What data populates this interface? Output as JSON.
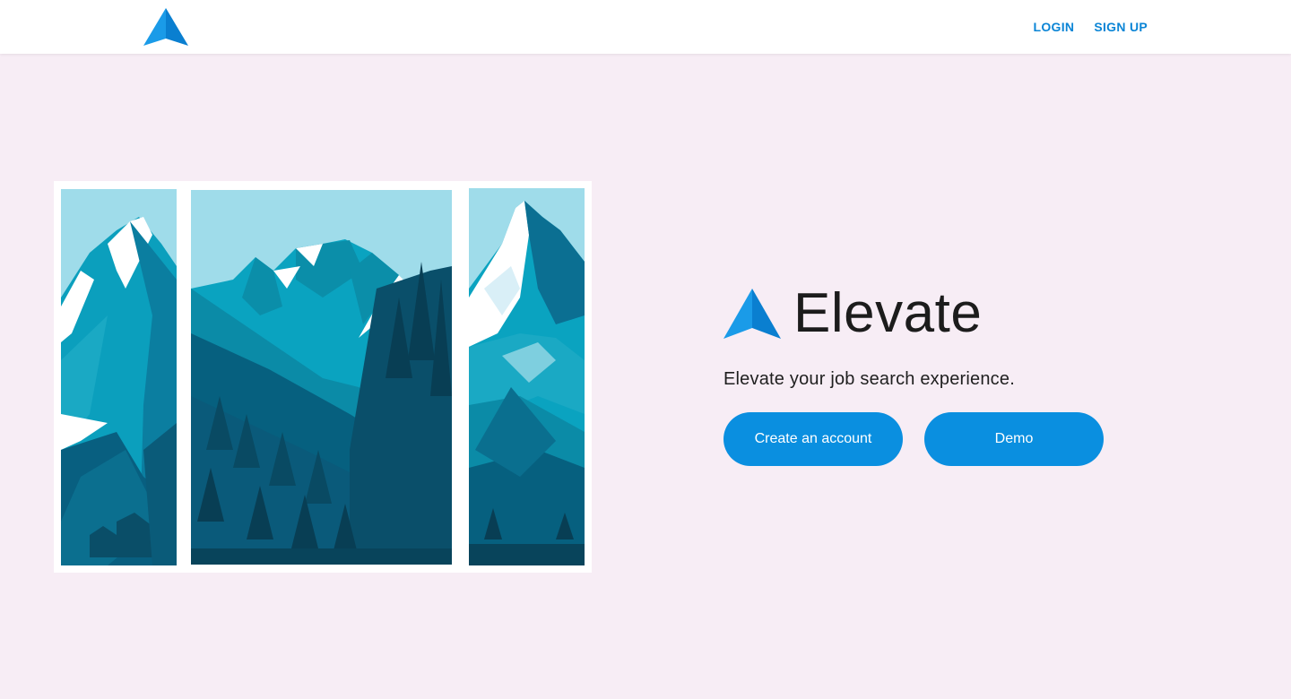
{
  "nav": {
    "logo_icon": "elevate-arrow-logo-icon",
    "links": [
      {
        "label": "LOGIN"
      },
      {
        "label": "SIGN UP"
      }
    ]
  },
  "hero": {
    "brand_icon": "elevate-arrow-logo-icon",
    "brand_name": "Elevate",
    "tagline": "Elevate your job search experience.",
    "buttons": {
      "create_account": "Create an account",
      "demo": "Demo"
    }
  },
  "illustration": {
    "icon": "mountain-triptych-illustration"
  },
  "colors": {
    "accent": "#0a8fe0",
    "nav_link": "#0b85d6",
    "background": "#f7edf5",
    "heading": "#1c1c1c"
  }
}
